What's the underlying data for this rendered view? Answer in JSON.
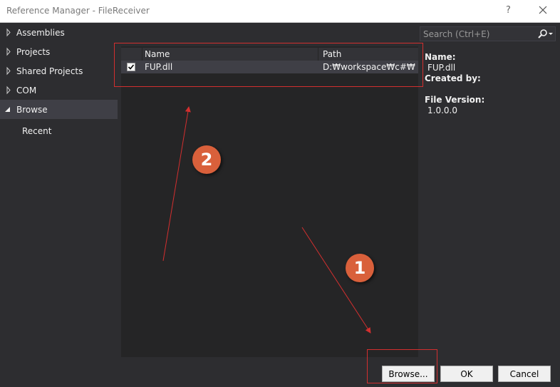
{
  "window": {
    "title": "Reference Manager - FileReceiver",
    "help_label": "?"
  },
  "nav": {
    "items": [
      {
        "label": "Assemblies"
      },
      {
        "label": "Projects"
      },
      {
        "label": "Shared Projects"
      },
      {
        "label": "COM"
      },
      {
        "label": "Browse"
      }
    ],
    "sub_item": "Recent"
  },
  "table": {
    "columns": [
      "Name",
      "Path"
    ],
    "rows": [
      {
        "checked": true,
        "name": "FUP.dll",
        "path": "D:₩workspace₩c#₩st..."
      }
    ]
  },
  "search": {
    "placeholder": "Search (Ctrl+E)"
  },
  "details": {
    "name_label": "Name:",
    "name_value": "FUP.dll",
    "created_by_label": "Created by:",
    "file_version_label": "File Version:",
    "file_version_value": "1.0.0.0"
  },
  "buttons": {
    "browse": "Browse...",
    "ok": "OK",
    "cancel": "Cancel"
  },
  "annotations": {
    "badge_1": "1",
    "badge_2": "2",
    "color": "#d32f2f",
    "badge_color": "#d9603b"
  }
}
